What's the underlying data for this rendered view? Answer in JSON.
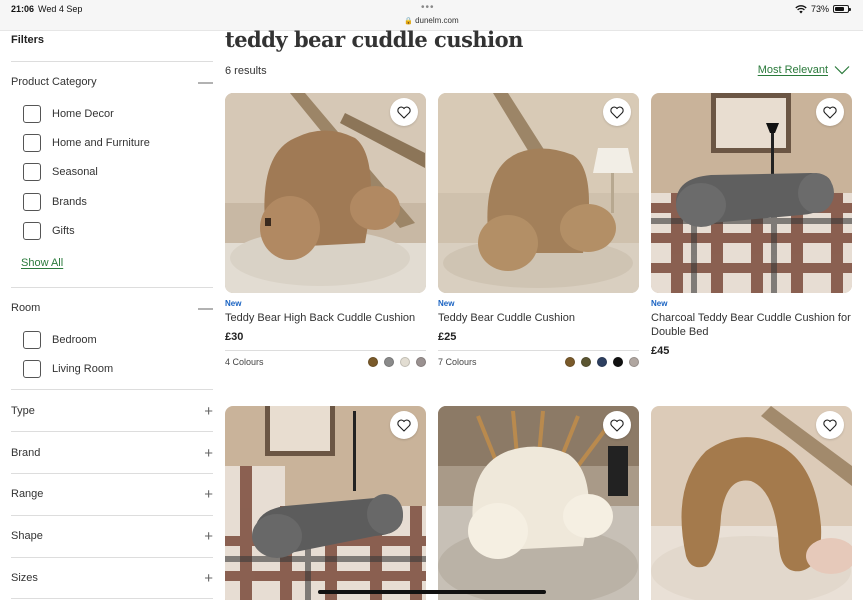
{
  "status_bar": {
    "time": "21:06",
    "date": "Wed 4 Sep",
    "url": "dunelm.com",
    "battery": "73%"
  },
  "sidebar": {
    "title": "Filters",
    "product_category": {
      "label": "Product Category",
      "toggle": "—",
      "items": [
        "Home Decor",
        "Home and Furniture",
        "Seasonal",
        "Brands",
        "Gifts"
      ],
      "show_all": "Show All"
    },
    "room": {
      "label": "Room",
      "toggle": "—",
      "items": [
        "Bedroom",
        "Living Room"
      ]
    },
    "collapsed": [
      {
        "label": "Type",
        "toggle": "+"
      },
      {
        "label": "Brand",
        "toggle": "+"
      },
      {
        "label": "Range",
        "toggle": "+"
      },
      {
        "label": "Shape",
        "toggle": "+"
      },
      {
        "label": "Sizes",
        "toggle": "+"
      }
    ]
  },
  "main": {
    "title": "teddy bear cuddle cushion",
    "results": "6 results",
    "sort_label": "Most Relevant",
    "products": [
      {
        "badge": "New",
        "name": "Teddy Bear High Back Cuddle Cushion",
        "price": "£30",
        "colours_label": "4 Colours",
        "swatches": [
          "#7a5a2a",
          "#8a8a8a",
          "#e2ddd2",
          "#9a9190"
        ]
      },
      {
        "badge": "New",
        "name": "Teddy Bear Cuddle Cushion",
        "price": "£25",
        "colours_label": "7 Colours",
        "swatches": [
          "#7a5a2a",
          "#5c5632",
          "#2d3f60",
          "#111111",
          "#b0a6a0"
        ]
      },
      {
        "badge": "New",
        "name": "Charcoal Teddy Bear Cuddle Cushion for Double Bed",
        "price": "£45"
      },
      {
        "badge": "",
        "name": "",
        "price": ""
      },
      {
        "badge": "",
        "name": "",
        "price": ""
      },
      {
        "badge": "",
        "name": "",
        "price": ""
      }
    ]
  },
  "colors": {
    "accent_green": "#2a7a3b",
    "badge_blue": "#1a63c2"
  },
  "icons": [
    "lock-icon",
    "wifi-icon",
    "battery-icon",
    "heart-icon",
    "chevron-down-icon"
  ]
}
